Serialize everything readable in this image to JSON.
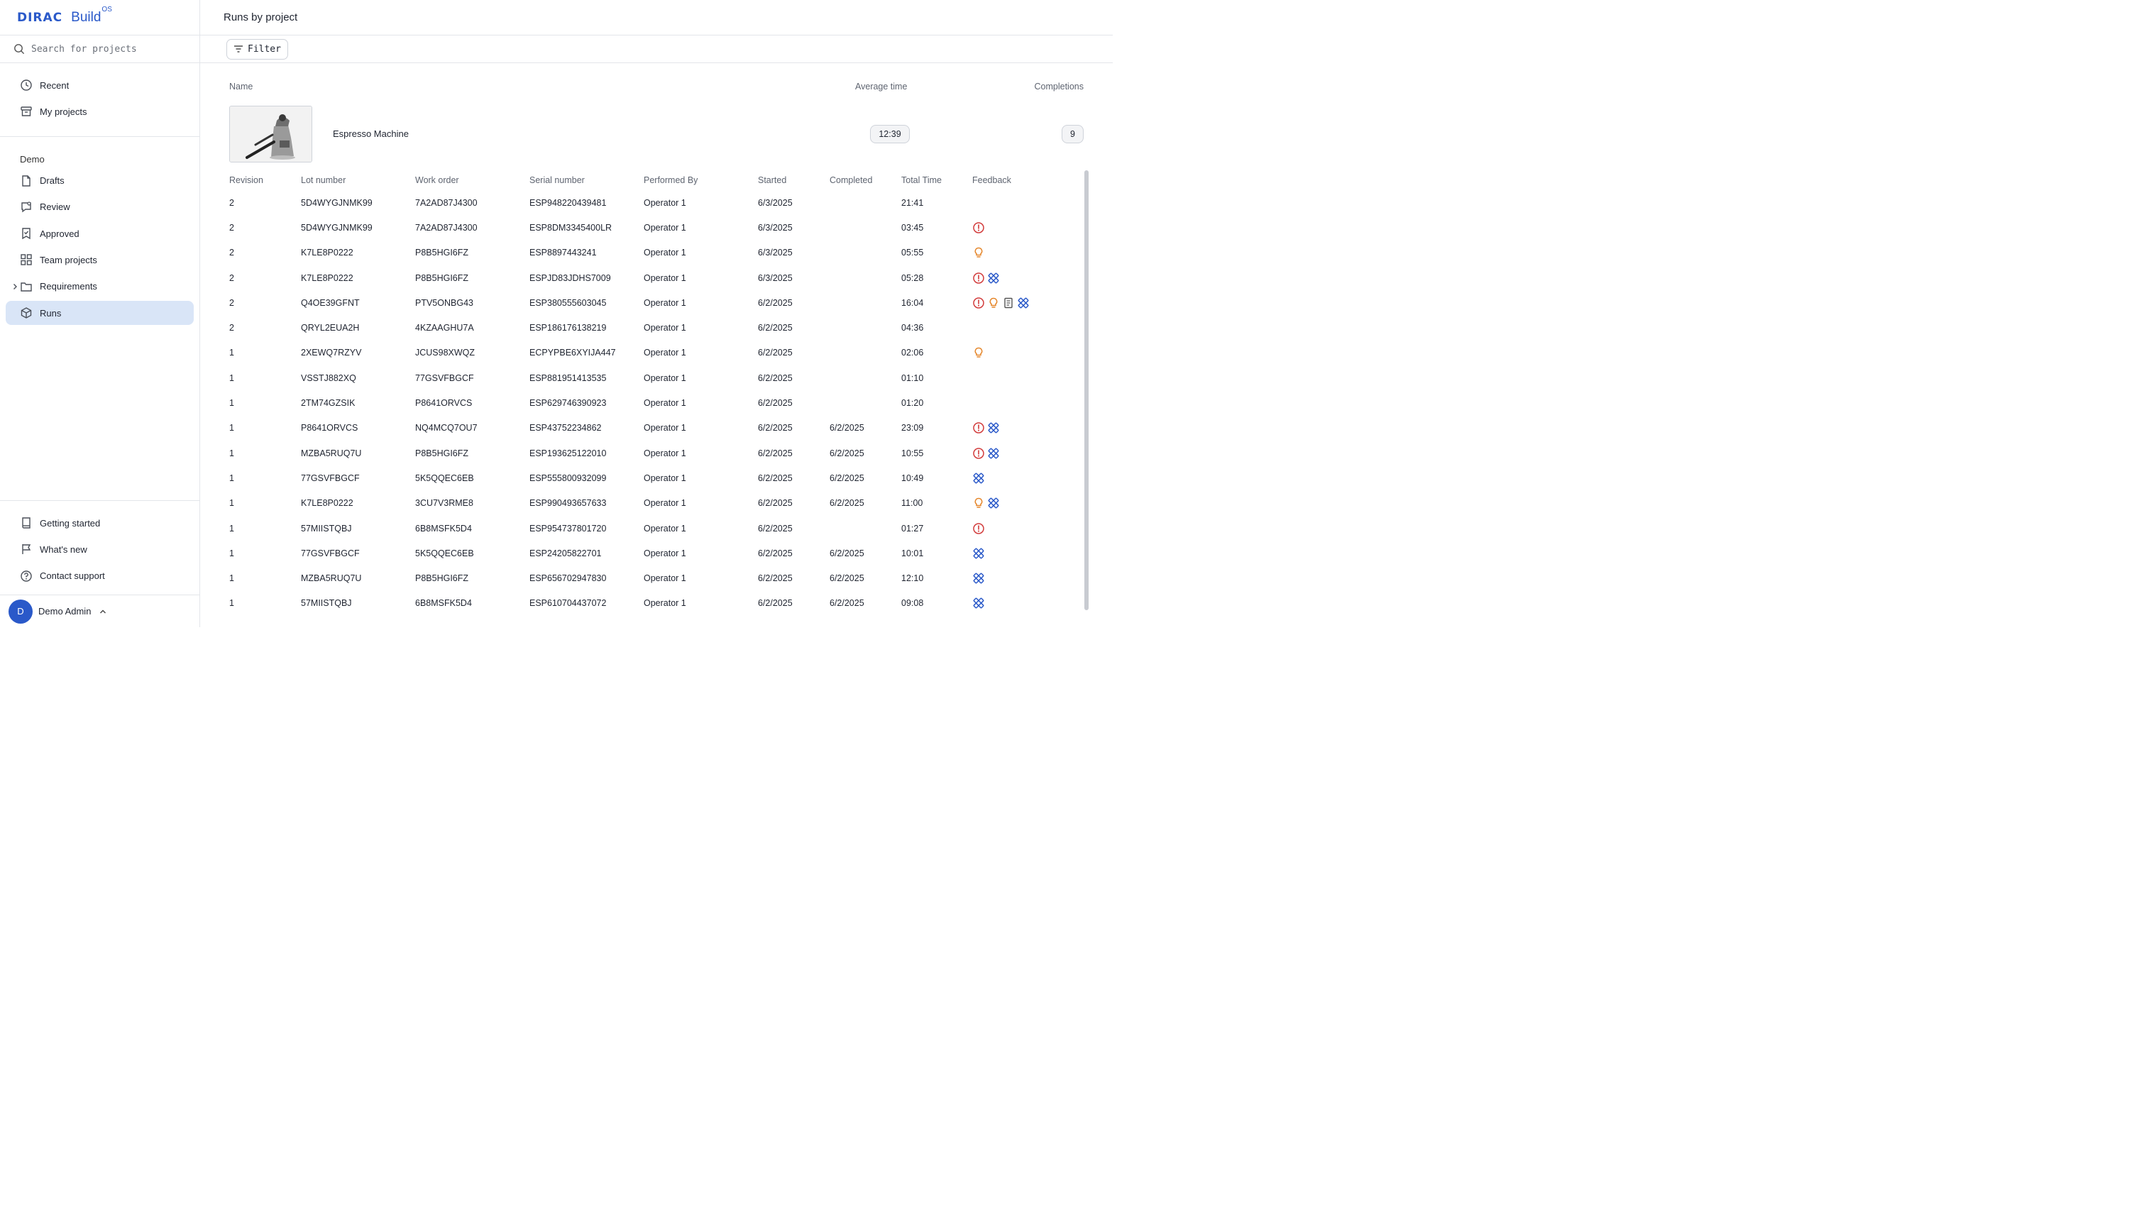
{
  "brand": {
    "logo": "DIRAC",
    "product": "Build",
    "superscript": "OS"
  },
  "search": {
    "placeholder": "Search for projects"
  },
  "nav_top": [
    {
      "label": "Recent",
      "icon": "clock-icon"
    },
    {
      "label": "My projects",
      "icon": "archive-icon"
    }
  ],
  "workspace": {
    "label": "Demo",
    "items": [
      {
        "label": "Drafts",
        "icon": "file-icon"
      },
      {
        "label": "Review",
        "icon": "message-icon"
      },
      {
        "label": "Approved",
        "icon": "badge-check-icon"
      },
      {
        "label": "Team projects",
        "icon": "grid-icon"
      },
      {
        "label": "Requirements",
        "icon": "folder-icon"
      },
      {
        "label": "Runs",
        "icon": "cube-icon"
      }
    ]
  },
  "nav_bottom": [
    {
      "label": "Getting started",
      "icon": "book-icon"
    },
    {
      "label": "What's new",
      "icon": "flag-icon"
    },
    {
      "label": "Contact support",
      "icon": "help-icon"
    }
  ],
  "user": {
    "initial": "D",
    "name": "Demo Admin"
  },
  "page": {
    "title": "Runs by project",
    "filter_label": "Filter"
  },
  "project_header": {
    "name": "Name",
    "avg": "Average time",
    "completions": "Completions"
  },
  "project": {
    "name": "Espresso Machine",
    "avg_time": "12:39",
    "completions": "9"
  },
  "runs_header": [
    "Revision",
    "Lot number",
    "Work order",
    "Serial number",
    "Performed By",
    "Started",
    "Completed",
    "Total Time",
    "Feedback"
  ],
  "runs": [
    [
      "2",
      "5D4WYGJNMK99",
      "7A2AD87J4300",
      "ESP948220439481",
      "Operator 1",
      "6/3/2025",
      "",
      "21:41",
      []
    ],
    [
      "2",
      "5D4WYGJNMK99",
      "7A2AD87J4300",
      "ESP8DM3345400LR",
      "Operator 1",
      "6/3/2025",
      "",
      "03:45",
      [
        "issue"
      ]
    ],
    [
      "2",
      "K7LE8P0222",
      "P8B5HGI6FZ",
      "ESP8897443241",
      "Operator 1",
      "6/3/2025",
      "",
      "05:55",
      [
        "idea"
      ]
    ],
    [
      "2",
      "K7LE8P0222",
      "P8B5HGI6FZ",
      "ESPJD83JDHS7009",
      "Operator 1",
      "6/3/2025",
      "",
      "05:28",
      [
        "issue",
        "tool"
      ]
    ],
    [
      "2",
      "Q4OE39GFNT",
      "PTV5ONBG43",
      "ESP380555603045",
      "Operator 1",
      "6/2/2025",
      "",
      "16:04",
      [
        "issue",
        "idea",
        "note",
        "tool"
      ]
    ],
    [
      "2",
      "QRYL2EUA2H",
      "4KZAAGHU7A",
      "ESP186176138219",
      "Operator 1",
      "6/2/2025",
      "",
      "04:36",
      []
    ],
    [
      "1",
      "2XEWQ7RZYV",
      "JCUS98XWQZ",
      "ECPYPBE6XYIJA447",
      "Operator 1",
      "6/2/2025",
      "",
      "02:06",
      [
        "idea"
      ]
    ],
    [
      "1",
      "VSSTJ882XQ",
      "77GSVFBGCF",
      "ESP881951413535",
      "Operator 1",
      "6/2/2025",
      "",
      "01:10",
      []
    ],
    [
      "1",
      "2TM74GZSIK",
      "P8641ORVCS",
      "ESP629746390923",
      "Operator 1",
      "6/2/2025",
      "",
      "01:20",
      []
    ],
    [
      "1",
      "P8641ORVCS",
      "NQ4MCQ7OU7",
      "ESP43752234862",
      "Operator 1",
      "6/2/2025",
      "6/2/2025",
      "23:09",
      [
        "issue",
        "tool"
      ]
    ],
    [
      "1",
      "MZBA5RUQ7U",
      "P8B5HGI6FZ",
      "ESP193625122010",
      "Operator 1",
      "6/2/2025",
      "6/2/2025",
      "10:55",
      [
        "issue",
        "tool"
      ]
    ],
    [
      "1",
      "77GSVFBGCF",
      "5K5QQEC6EB",
      "ESP555800932099",
      "Operator 1",
      "6/2/2025",
      "6/2/2025",
      "10:49",
      [
        "tool"
      ]
    ],
    [
      "1",
      "K7LE8P0222",
      "3CU7V3RME8",
      "ESP990493657633",
      "Operator 1",
      "6/2/2025",
      "6/2/2025",
      "11:00",
      [
        "idea",
        "tool"
      ]
    ],
    [
      "1",
      "57MIISTQBJ",
      "6B8MSFK5D4",
      "ESP954737801720",
      "Operator 1",
      "6/2/2025",
      "",
      "01:27",
      [
        "issue"
      ]
    ],
    [
      "1",
      "77GSVFBGCF",
      "5K5QQEC6EB",
      "ESP24205822701",
      "Operator 1",
      "6/2/2025",
      "6/2/2025",
      "10:01",
      [
        "tool"
      ]
    ],
    [
      "1",
      "MZBA5RUQ7U",
      "P8B5HGI6FZ",
      "ESP656702947830",
      "Operator 1",
      "6/2/2025",
      "6/2/2025",
      "12:10",
      [
        "tool"
      ]
    ],
    [
      "1",
      "57MIISTQBJ",
      "6B8MSFK5D4",
      "ESP610704437072",
      "Operator 1",
      "6/2/2025",
      "6/2/2025",
      "09:08",
      [
        "tool"
      ]
    ]
  ],
  "colors": {
    "accent": "#2a59c9",
    "issue": "#d23b3b",
    "idea": "#e5862a",
    "tool": "#2a59c9",
    "active_nav": "#d9e5f7"
  }
}
